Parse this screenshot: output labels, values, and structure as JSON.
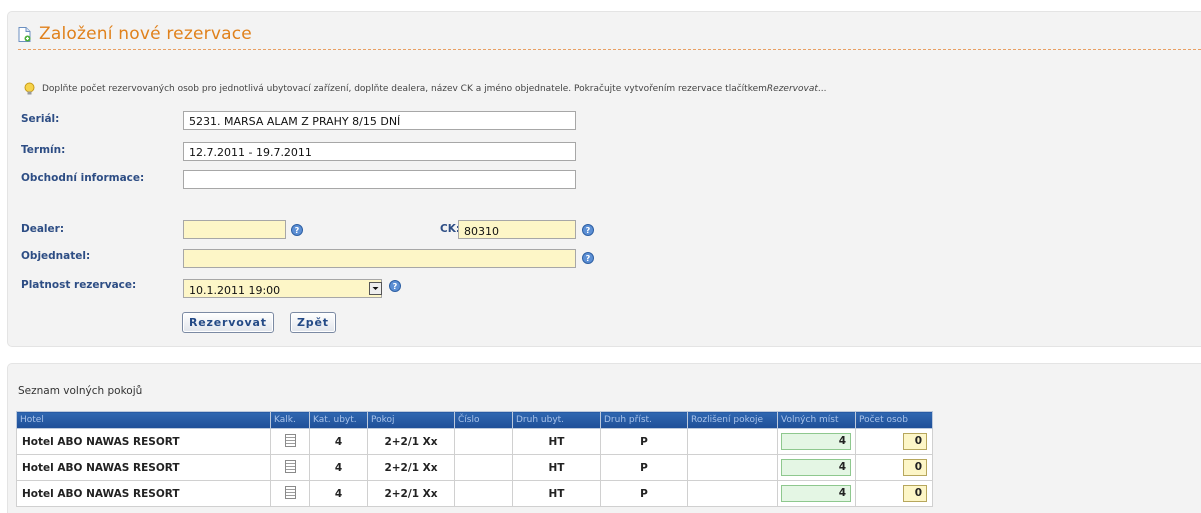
{
  "header": {
    "title": "Založení nové rezervace"
  },
  "hint": {
    "text": "Doplňte počet rezervovaných osob pro jednotlivá ubytovací zařízení, doplňte dealera, název CK a jméno objednatele. Pokračujte vytvořením rezervace tlačítkem ",
    "emph": "Rezervovat",
    "tail": " ..."
  },
  "form": {
    "serial_label": "Seriál:",
    "serial_value": "5231. MARSA ALAM Z PRAHY 8/15 DNÍ",
    "termin_label": "Termín:",
    "termin_value": "12.7.2011 - 19.7.2011",
    "obchodni_label": "Obchodní informace:",
    "obchodni_value": "",
    "dealer_label": "Dealer:",
    "dealer_value": "",
    "ck_label": "CK:",
    "ck_value": "80310",
    "objednatel_label": "Objednatel:",
    "objednatel_value": "",
    "platnost_label": "Platnost rezervace:",
    "platnost_value": "10.1.2011 19:00"
  },
  "buttons": {
    "rezervovat": "Rezervovat",
    "zpet": "Zpět"
  },
  "rooms": {
    "title": "Seznam volných pokojů",
    "columns": [
      "Hotel",
      "Kalk.",
      "Kat. ubyt.",
      "Pokoj",
      "Číslo",
      "Druh ubyt.",
      "Druh příst.",
      "Rozlišení pokoje",
      "Volných míst",
      "Počet osob"
    ],
    "rows": [
      {
        "hotel": "Hotel ABO NAWAS RESORT",
        "kat": "4",
        "pokoj": "2+2/1 Xx",
        "cislo": "",
        "druh_ubyt": "HT",
        "druh_prist": "P",
        "rozliseni": "",
        "volnych": "4",
        "pocet": "0"
      },
      {
        "hotel": "Hotel ABO NAWAS RESORT",
        "kat": "4",
        "pokoj": "2+2/1 Xx",
        "cislo": "",
        "druh_ubyt": "HT",
        "druh_prist": "P",
        "rozliseni": "",
        "volnych": "4",
        "pocet": "0"
      },
      {
        "hotel": "Hotel ABO NAWAS RESORT",
        "kat": "4",
        "pokoj": "2+2/1 Xx",
        "cislo": "",
        "druh_ubyt": "HT",
        "druh_prist": "P",
        "rozliseni": "",
        "volnych": "4",
        "pocet": "0"
      }
    ]
  },
  "icons": {
    "title": "document-icon",
    "hint": "lightbulb-icon",
    "help": "help-icon",
    "calc": "calculator-icon",
    "dropdown": "chevron-down-icon"
  },
  "colors": {
    "title": "#e0811c",
    "label": "#2d4d84",
    "header_bg": "#2f67b1",
    "input_highlight": "#fdf6c7"
  }
}
